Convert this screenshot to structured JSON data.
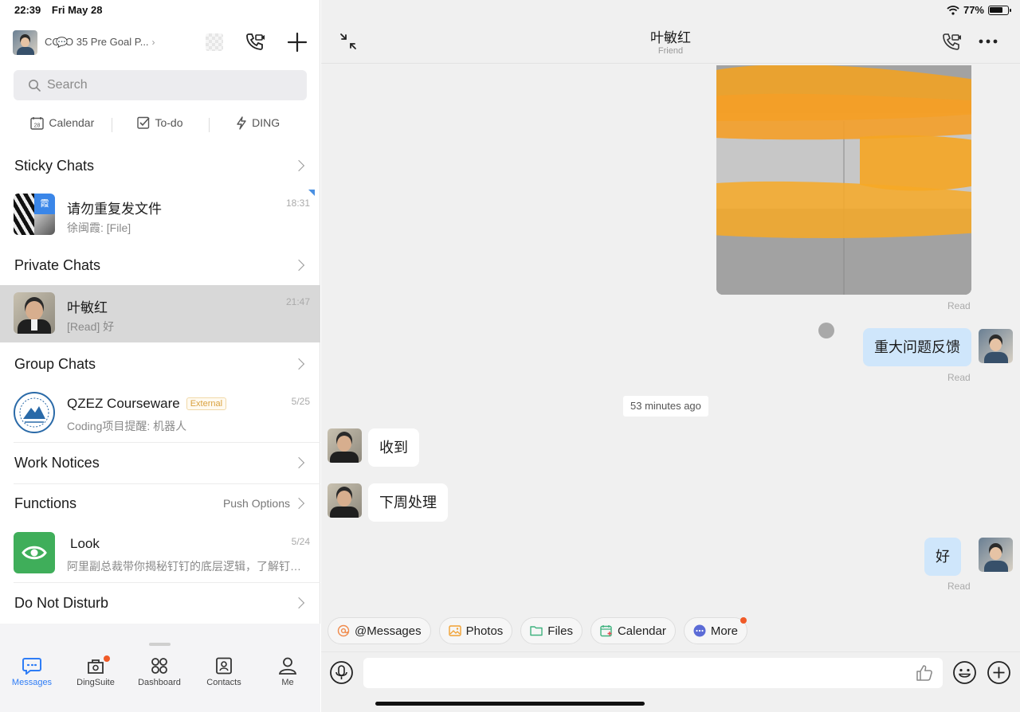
{
  "status": {
    "time": "22:39",
    "date": "Fri May 28",
    "battery": "77%",
    "battery_level": 0.77
  },
  "top": {
    "org_label": "CChO 35 Pre Goal P...",
    "icons": [
      "qr-icon",
      "video-call-icon",
      "plus-icon"
    ]
  },
  "search": {
    "placeholder": "Search"
  },
  "quick_actions": [
    {
      "label": "Calendar",
      "icon": "calendar-icon",
      "day": "28"
    },
    {
      "label": "To-do",
      "icon": "checkbox-icon"
    },
    {
      "label": "DING",
      "icon": "lightning-icon"
    }
  ],
  "sections": {
    "sticky": "Sticky Chats",
    "private": "Private Chats",
    "group": "Group Chats",
    "work": "Work Notices",
    "functions": "Functions",
    "functions_right": "Push Options",
    "dnd": "Do Not Disturb"
  },
  "chats": {
    "sticky": {
      "name": "请勿重复发文件",
      "preview": "徐闽霞: [File]",
      "time": "18:31",
      "badge_text": "霞"
    },
    "private": {
      "name": "叶敏红",
      "preview": "[Read] 好",
      "time": "21:47"
    },
    "group": {
      "name": "QZEZ Courseware",
      "tag": "External",
      "preview": "Coding项目提醒: 机器人",
      "time": "5/25"
    },
    "look": {
      "name": "Look",
      "preview": "阿里副总裁带你揭秘钉钉的底层逻辑，了解钉钉的工作方式",
      "time": "5/24"
    }
  },
  "tabbar": [
    {
      "label": "Messages",
      "icon": "messages-icon",
      "active": true
    },
    {
      "label": "DingSuite",
      "icon": "dingsuite-icon",
      "dot": true
    },
    {
      "label": "Dashboard",
      "icon": "dashboard-icon"
    },
    {
      "label": "Contacts",
      "icon": "contacts-icon"
    },
    {
      "label": "Me",
      "icon": "person-icon"
    }
  ],
  "conversation": {
    "title": "叶敏红",
    "subtitle": "Friend",
    "messages": [
      {
        "from": "me",
        "type": "image",
        "status": "Read"
      },
      {
        "from": "me",
        "type": "text",
        "text": "重大问题反馈",
        "status": "Read"
      },
      {
        "type": "timestamp",
        "text": "53 minutes ago"
      },
      {
        "from": "them",
        "type": "text",
        "text": "收到"
      },
      {
        "from": "them",
        "type": "text",
        "text": "下周处理"
      },
      {
        "from": "me",
        "type": "text",
        "text": "好",
        "status": "Read"
      }
    ]
  },
  "shortcuts": [
    {
      "label": "@Messages",
      "icon": "at-icon",
      "color": "#f08a4b"
    },
    {
      "label": "Photos",
      "icon": "photo-icon",
      "color": "#f0a030"
    },
    {
      "label": "Files",
      "icon": "folder-icon",
      "color": "#3fb27f"
    },
    {
      "label": "Calendar",
      "icon": "calendar-add-icon",
      "color": "#3fb27f"
    },
    {
      "label": "More",
      "icon": "more-icon",
      "color": "#5b6bd6",
      "dot": true
    }
  ],
  "colors": {
    "accent": "#2f7df6",
    "my_bubble": "#cfe6fb",
    "notify_dot": "#f05a28",
    "look_green": "#3fae5a"
  }
}
